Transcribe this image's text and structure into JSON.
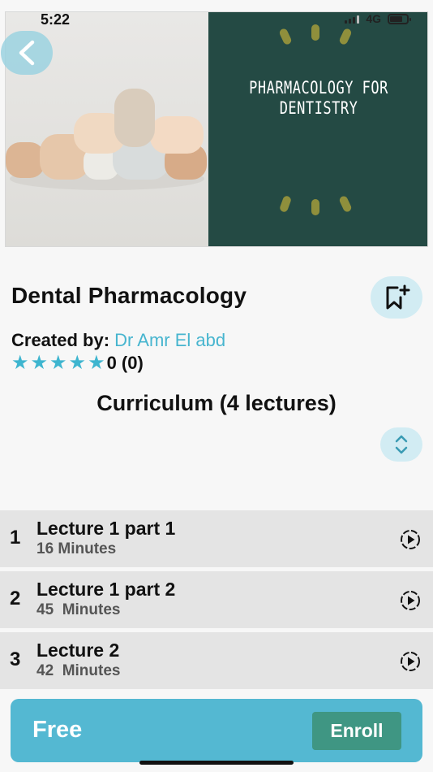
{
  "status_bar": {
    "time": "5:22",
    "network": "4G"
  },
  "hero": {
    "image_title": "PHARMACOLOGY FOR DENTISTRY",
    "panel_color": "#244a44",
    "accent_color": "#8f8f3c"
  },
  "nav": {
    "back_icon": "chevron-left-icon"
  },
  "course": {
    "title": "Dental Pharmacology",
    "created_label": "Created by:",
    "author": "Dr Amr El abd",
    "rating_text": "0 (0)",
    "star_count": 5,
    "bookmark_icon": "bookmark-add-icon"
  },
  "curriculum": {
    "title": "Curriculum (4 lectures)",
    "expand_icon": "chevron-up-down-icon",
    "lectures": [
      {
        "number": "1",
        "title": "Lecture 1 part 1",
        "duration": "16 Minutes"
      },
      {
        "number": "2",
        "title": "Lecture 1 part 2",
        "duration": "45  Minutes"
      },
      {
        "number": "3",
        "title": "Lecture 2",
        "duration": "42  Minutes"
      }
    ]
  },
  "enroll": {
    "price": "Free",
    "button_label": "Enroll"
  },
  "colors": {
    "accent": "#47b5cf",
    "enroll_bar": "#54b8d2",
    "enroll_button": "#3f9683"
  }
}
